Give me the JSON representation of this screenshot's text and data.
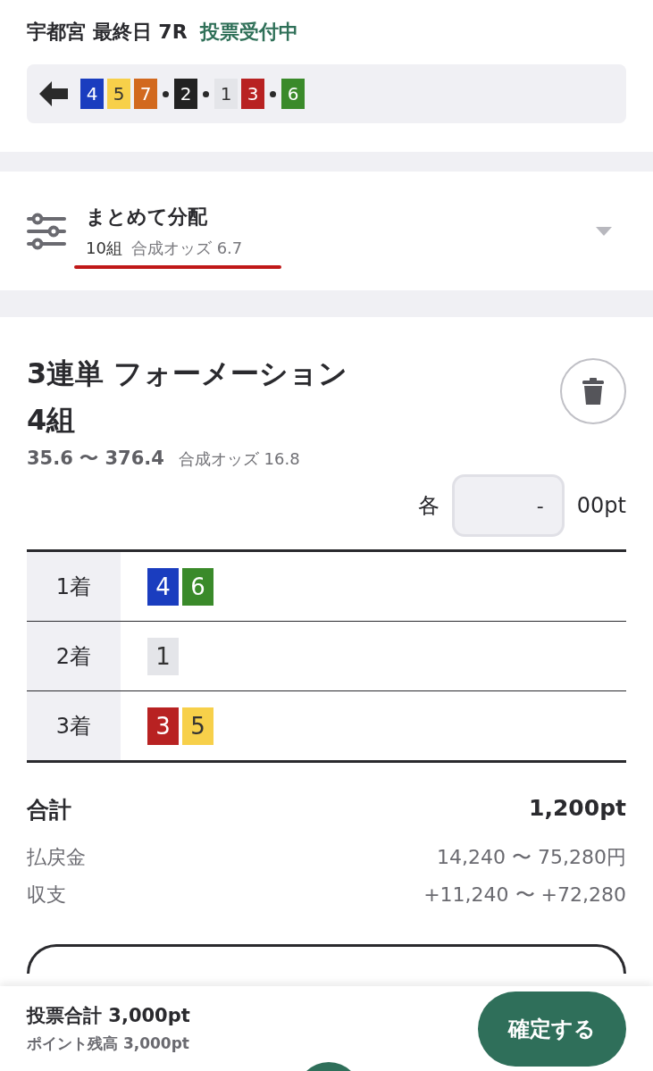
{
  "header": {
    "venue": "宇都宮 最終日 7R",
    "status": "投票受付中"
  },
  "prediction": {
    "groups": [
      [
        {
          "number": "4",
          "color": "#1a3dbf"
        },
        {
          "number": "5",
          "color": "#f7d04a"
        },
        {
          "number": "7",
          "color": "#d2691e"
        }
      ],
      [
        {
          "number": "2",
          "color": "#222222"
        }
      ],
      [
        {
          "number": "1",
          "color": "#e4e5e9"
        },
        {
          "number": "3",
          "color": "#b82222"
        }
      ],
      [
        {
          "number": "6",
          "color": "#3a8a2a"
        }
      ]
    ]
  },
  "distribution": {
    "title": "まとめて分配",
    "count": "10組",
    "odds": "合成オッズ 6.7",
    "expanded": false
  },
  "bet": {
    "title": "3連単 フォーメーション",
    "count": "4組",
    "range": "35.6 〜 376.4",
    "odds": "合成オッズ 16.8",
    "each_label": "各",
    "amount": "-",
    "amount_suffix": "00pt",
    "positions": [
      {
        "label": "1着",
        "numbers": [
          {
            "number": "4",
            "color": "#1a3dbf"
          },
          {
            "number": "6",
            "color": "#3a8a2a"
          }
        ]
      },
      {
        "label": "2着",
        "numbers": [
          {
            "number": "1",
            "color": "#e4e5e9"
          }
        ]
      },
      {
        "label": "3着",
        "numbers": [
          {
            "number": "3",
            "color": "#b82222"
          },
          {
            "number": "5",
            "color": "#f7d04a"
          }
        ]
      }
    ]
  },
  "totals": {
    "label": "合計",
    "value": "1,200pt",
    "rows": [
      {
        "label": "払戻金",
        "value": "14,240 〜 75,280円"
      },
      {
        "label": "収支",
        "value": "+11,240 〜 +72,280"
      }
    ]
  },
  "footer": {
    "total": "投票合計 3,000pt",
    "balance": "ポイント残高 3,000pt",
    "confirm": "確定する"
  }
}
